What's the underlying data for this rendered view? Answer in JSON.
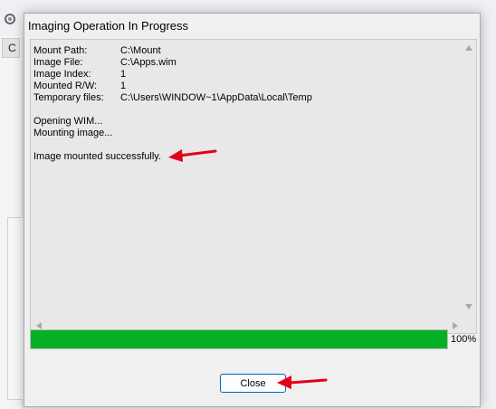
{
  "background_app": {
    "tab_letter": "C"
  },
  "dialog": {
    "title": "Imaging Operation In Progress"
  },
  "details": [
    {
      "label": "Mount Path:",
      "value": "C:\\Mount"
    },
    {
      "label": "Image File:",
      "value": "C:\\Apps.wim"
    },
    {
      "label": "Image Index:",
      "value": "1"
    },
    {
      "label": "Mounted R/W:",
      "value": "1"
    },
    {
      "label": "Temporary files:",
      "value": "C:\\Users\\WINDOW~1\\AppData\\Local\\Temp"
    }
  ],
  "log": {
    "line1": "Opening WIM...",
    "line2": "Mounting image...",
    "line3": "Image mounted successfully."
  },
  "progress": {
    "value": 100,
    "label": "100%"
  },
  "buttons": {
    "close": "Close"
  },
  "colors": {
    "progress_fill": "#06b025",
    "annotation_arrow": "#e3001b",
    "button_border": "#0067c0"
  },
  "icons": {
    "app": "app-gear-icon",
    "annotation": "red-arrow-icon"
  }
}
